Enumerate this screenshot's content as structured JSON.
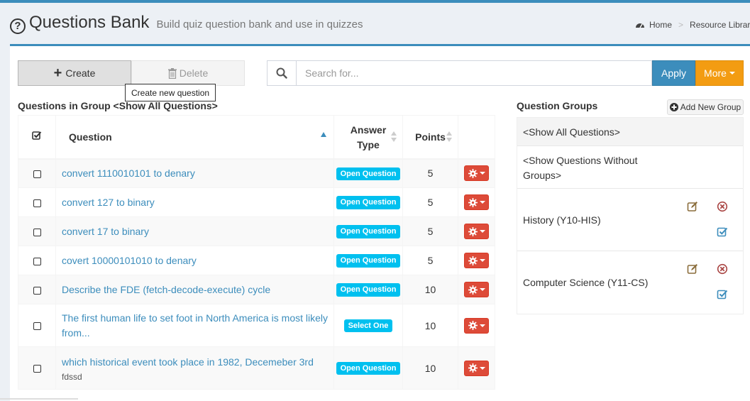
{
  "header": {
    "title": "Questions Bank",
    "subtitle": "Build quiz question bank and use in quizzes",
    "breadcrumb": [
      "Home",
      "Resource Library"
    ]
  },
  "toolbar": {
    "create_label": "Create",
    "delete_label": "Delete",
    "tooltip": "Create new question",
    "search_placeholder": "Search for...",
    "apply_label": "Apply",
    "more_label": "More"
  },
  "questions": {
    "title": "Questions in Group <Show All Questions>",
    "columns": {
      "question": "Question",
      "answer_type": "Answer Type",
      "points": "Points"
    },
    "rows": [
      {
        "question": "convert 1110010101 to denary",
        "sub": "",
        "type": "Open Question",
        "points": "5"
      },
      {
        "question": "convert 127 to binary",
        "sub": "",
        "type": "Open Question",
        "points": "5"
      },
      {
        "question": "convert 17 to binary",
        "sub": "",
        "type": "Open Question",
        "points": "5"
      },
      {
        "question": "covert 10000101010 to denary",
        "sub": "",
        "type": "Open Question",
        "points": "5"
      },
      {
        "question": "Describe the FDE (fetch-decode-execute) cycle",
        "sub": "",
        "type": "Open Question",
        "points": "10"
      },
      {
        "question": "The first human life to set foot in North America is most likely from...",
        "sub": "",
        "type": "Select One",
        "points": "10"
      },
      {
        "question": "which historical event took place in 1982, Decemeber 3rd",
        "sub": "fdssd",
        "type": "Open Question",
        "points": "10"
      }
    ]
  },
  "groups": {
    "title": "Question Groups",
    "add_label": "Add New Group",
    "items": [
      "<Show All Questions>",
      "<Show Questions Without Groups>",
      "History (Y10-HIS)",
      "Computer Science (Y11-CS)"
    ]
  },
  "colors": {
    "primary": "#3c8dbc",
    "warning": "#f39c12",
    "danger": "#dd4b39",
    "info": "#00c0ef",
    "edit_icon": "#8a6d3b",
    "remove_icon": "#a94442"
  }
}
